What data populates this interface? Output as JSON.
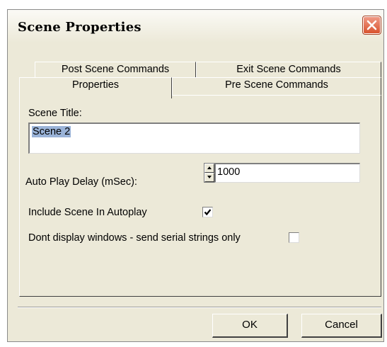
{
  "window": {
    "title": "Scene Properties"
  },
  "tabs": {
    "row1": [
      {
        "label": "Post Scene Commands"
      },
      {
        "label": "Exit Scene Commands"
      }
    ],
    "row2": [
      {
        "label": "Properties",
        "active": true
      },
      {
        "label": "Pre Scene Commands"
      }
    ]
  },
  "form": {
    "scene_title_label": "Scene Title:",
    "scene_title_value": "Scene 2",
    "auto_play_delay_label": "Auto Play Delay (mSec):",
    "auto_play_delay_value": "1000",
    "include_autoplay_label": "Include Scene In Autoplay",
    "include_autoplay_checked": true,
    "serial_only_label": "Dont display windows - send serial strings only",
    "serial_only_checked": false
  },
  "buttons": {
    "ok_label": "OK",
    "cancel_label": "Cancel"
  },
  "colors": {
    "dialog_face": "#ECE9D8",
    "close_button": "#d9532f",
    "text_selection": "#9ab3d8"
  },
  "icons": {
    "close": "close-x-icon",
    "spin_up": "triangle-up-icon",
    "spin_down": "triangle-down-icon",
    "check": "checkmark-icon"
  }
}
